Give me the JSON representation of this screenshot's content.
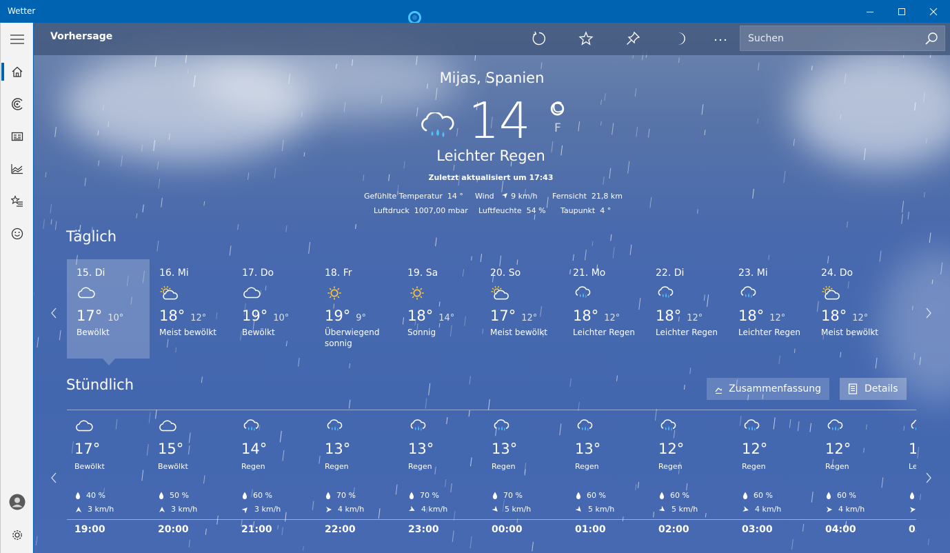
{
  "window": {
    "title": "Wetter"
  },
  "header": {
    "title": "Vorhersage",
    "search_placeholder": "Suchen"
  },
  "current": {
    "location": "Mijas, Spanien",
    "temperature": "14",
    "degree": "°",
    "unit_c": "C",
    "unit_f": "F",
    "condition": "Leichter Regen",
    "condition_icon": "cloud-rain-icon",
    "updated": "Zuletzt aktualisiert um 17:43",
    "details": {
      "feels_like": {
        "label": "Gefühlte Temperatur",
        "value": "14 °"
      },
      "wind": {
        "label": "Wind",
        "value": "9 km/h"
      },
      "visibility": {
        "label": "Fernsicht",
        "value": "21,8 km"
      },
      "pressure": {
        "label": "Luftdruck",
        "value": "1007,00 mbar"
      },
      "humidity": {
        "label": "Luftfeuchte",
        "value": "54 %"
      },
      "dewpoint": {
        "label": "Taupunkt",
        "value": "4 °"
      }
    }
  },
  "daily": {
    "title": "Täglich",
    "days": [
      {
        "date": "15. Di",
        "icon": "cloudy",
        "high": "17°",
        "low": "10°",
        "cond": "Bewölkt",
        "selected": true
      },
      {
        "date": "16. Mi",
        "icon": "partly-sunny",
        "high": "18°",
        "low": "12°",
        "cond": "Meist bewölkt"
      },
      {
        "date": "17. Do",
        "icon": "cloudy",
        "high": "19°",
        "low": "10°",
        "cond": "Bewölkt"
      },
      {
        "date": "18. Fr",
        "icon": "sunny",
        "high": "19°",
        "low": "9°",
        "cond": "Überwiegend sonnig"
      },
      {
        "date": "19. Sa",
        "icon": "sunny",
        "high": "18°",
        "low": "14°",
        "cond": "Sonnig"
      },
      {
        "date": "20. So",
        "icon": "partly-sunny",
        "high": "17°",
        "low": "12°",
        "cond": "Meist bewölkt"
      },
      {
        "date": "21. Mo",
        "icon": "rain",
        "high": "18°",
        "low": "12°",
        "cond": "Leichter Regen"
      },
      {
        "date": "22. Di",
        "icon": "rain",
        "high": "18°",
        "low": "12°",
        "cond": "Leichter Regen"
      },
      {
        "date": "23. Mi",
        "icon": "rain",
        "high": "18°",
        "low": "12°",
        "cond": "Leichter Regen"
      },
      {
        "date": "24. Do",
        "icon": "partly-sunny",
        "high": "18°",
        "low": "12°",
        "cond": "Meist bewölkt"
      }
    ]
  },
  "hourly": {
    "title": "Stündlich",
    "summary_label": "Zusammenfassung",
    "details_label": "Details",
    "hours": [
      {
        "time": "19:00",
        "icon": "cloudy",
        "temp": "17°",
        "cond": "Bewölkt",
        "rain": "40 %",
        "wind": "3 km/h",
        "wind_dir": 45
      },
      {
        "time": "20:00",
        "icon": "cloudy",
        "temp": "15°",
        "cond": "Bewölkt",
        "rain": "50 %",
        "wind": "3 km/h",
        "wind_dir": 45
      },
      {
        "time": "21:00",
        "icon": "rain",
        "temp": "14°",
        "cond": "Regen",
        "rain": "60 %",
        "wind": "3 km/h",
        "wind_dir": 90
      },
      {
        "time": "22:00",
        "icon": "rain",
        "temp": "13°",
        "cond": "Regen",
        "rain": "70 %",
        "wind": "4 km/h",
        "wind_dir": 135
      },
      {
        "time": "23:00",
        "icon": "rain",
        "temp": "13°",
        "cond": "Regen",
        "rain": "70 %",
        "wind": "4 km/h",
        "wind_dir": 160
      },
      {
        "time": "00:00",
        "icon": "rain",
        "temp": "13°",
        "cond": "Regen",
        "rain": "70 %",
        "wind": "5 km/h",
        "wind_dir": 180
      },
      {
        "time": "01:00",
        "icon": "rain",
        "temp": "13°",
        "cond": "Regen",
        "rain": "60 %",
        "wind": "5 km/h",
        "wind_dir": 180
      },
      {
        "time": "02:00",
        "icon": "rain",
        "temp": "12°",
        "cond": "Regen",
        "rain": "60 %",
        "wind": "5 km/h",
        "wind_dir": 170
      },
      {
        "time": "03:00",
        "icon": "rain",
        "temp": "12°",
        "cond": "Regen",
        "rain": "60 %",
        "wind": "4 km/h",
        "wind_dir": 150
      },
      {
        "time": "04:00",
        "icon": "rain",
        "temp": "12°",
        "cond": "Regen",
        "rain": "60 %",
        "wind": "4 km/h",
        "wind_dir": 135
      },
      {
        "time": "05:00",
        "icon": "rain",
        "temp": "12°",
        "cond": "Leichter Regen",
        "rain": "60 %",
        "wind": "4 km/h",
        "wind_dir": 130
      }
    ]
  },
  "sidebar": {
    "items": [
      {
        "name": "menu-icon"
      },
      {
        "name": "home-icon",
        "active": true
      },
      {
        "name": "radar-icon"
      },
      {
        "name": "news-icon"
      },
      {
        "name": "history-chart-icon"
      },
      {
        "name": "favorites-list-icon"
      },
      {
        "name": "feedback-smiley-icon"
      },
      {
        "name": "account-icon"
      },
      {
        "name": "settings-icon"
      }
    ]
  },
  "colors": {
    "titlebar": "#0063b1",
    "accent": "#0063b1",
    "sidebar": "#f3f3f3",
    "header": "#405478"
  }
}
